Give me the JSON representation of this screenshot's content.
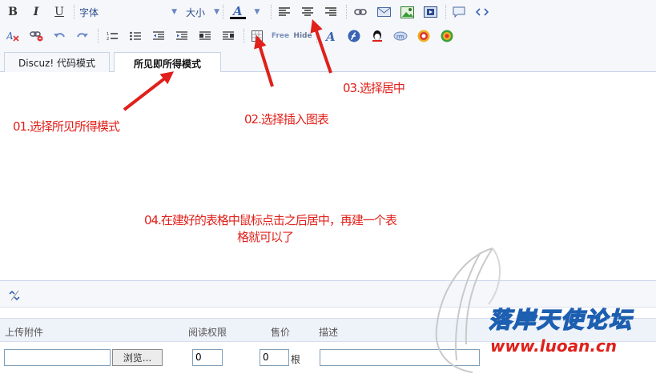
{
  "toolbar": {
    "font_label": "字体",
    "size_label": "大小",
    "bold_label": "B",
    "italic_label": "I",
    "underline_label": "U",
    "free_label": "Free",
    "hide_label": "Hide",
    "font_color_label": "A",
    "text_color": "#000000",
    "accent_color": "#2b4a8a"
  },
  "tabs": [
    {
      "label": "Discuz! 代码模式"
    },
    {
      "label": "所见即所得模式"
    }
  ],
  "annotations": {
    "step1": "01.选择所见所得模式",
    "step2": "02.选择插入图表",
    "step3": "03.选择居中",
    "step4_line1": "04.在建好的表格中鼠标点击之后居中，再建一个表",
    "step4_line2": "格就可以了",
    "color": "#e0201a"
  },
  "attachments": {
    "headers": {
      "upload": "上传附件",
      "read_perm": "阅读权限",
      "price": "售价",
      "description": "描述"
    },
    "browse_label": "浏览...",
    "read_perm_value": "0",
    "price_value": "0",
    "price_unit": "根"
  },
  "watermark": {
    "title": "落岸天使论坛",
    "url": "www.luoan.cn"
  }
}
